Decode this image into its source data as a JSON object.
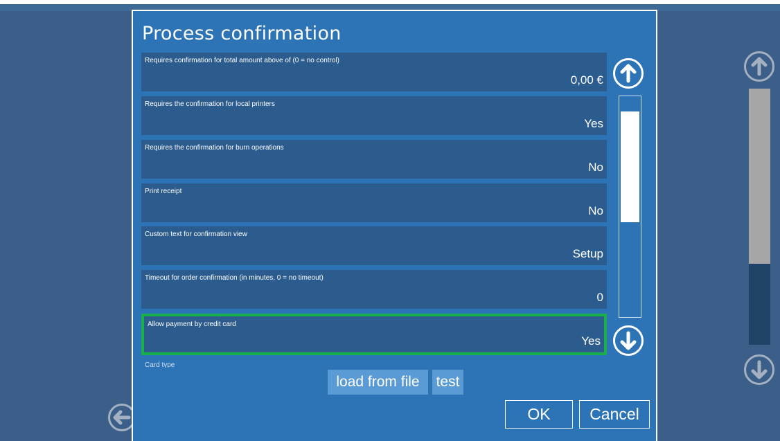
{
  "dialog": {
    "title": "Process confirmation"
  },
  "settings": [
    {
      "label": "Requires confirmation for total amount above of (0 = no control)",
      "value": "0,00 €"
    },
    {
      "label": "Requires the confirmation for local printers",
      "value": "Yes"
    },
    {
      "label": "Requires the confirmation for burn operations",
      "value": "No"
    },
    {
      "label": "Print receipt",
      "value": "No"
    },
    {
      "label": "Custom text for confirmation view",
      "value": "Setup"
    },
    {
      "label": "Timeout for order confirmation (in minutes, 0 = no timeout)",
      "value": "0"
    },
    {
      "label": "Allow payment by credit card",
      "value": "Yes",
      "selected": true
    }
  ],
  "partial_next_label": "Card type",
  "buttons": {
    "load_from_file": "load from file",
    "test": "test",
    "ok": "OK",
    "cancel": "Cancel"
  },
  "icons": {
    "scroll_up": "arrow-up-circle-icon",
    "scroll_down": "arrow-down-circle-icon",
    "back": "arrow-left-circle-icon"
  },
  "colors": {
    "dialog_bg": "#2d74b6",
    "row_bg": "#2c5c8d",
    "selection": "#19b04c",
    "button_fill": "#5a9bd6"
  }
}
